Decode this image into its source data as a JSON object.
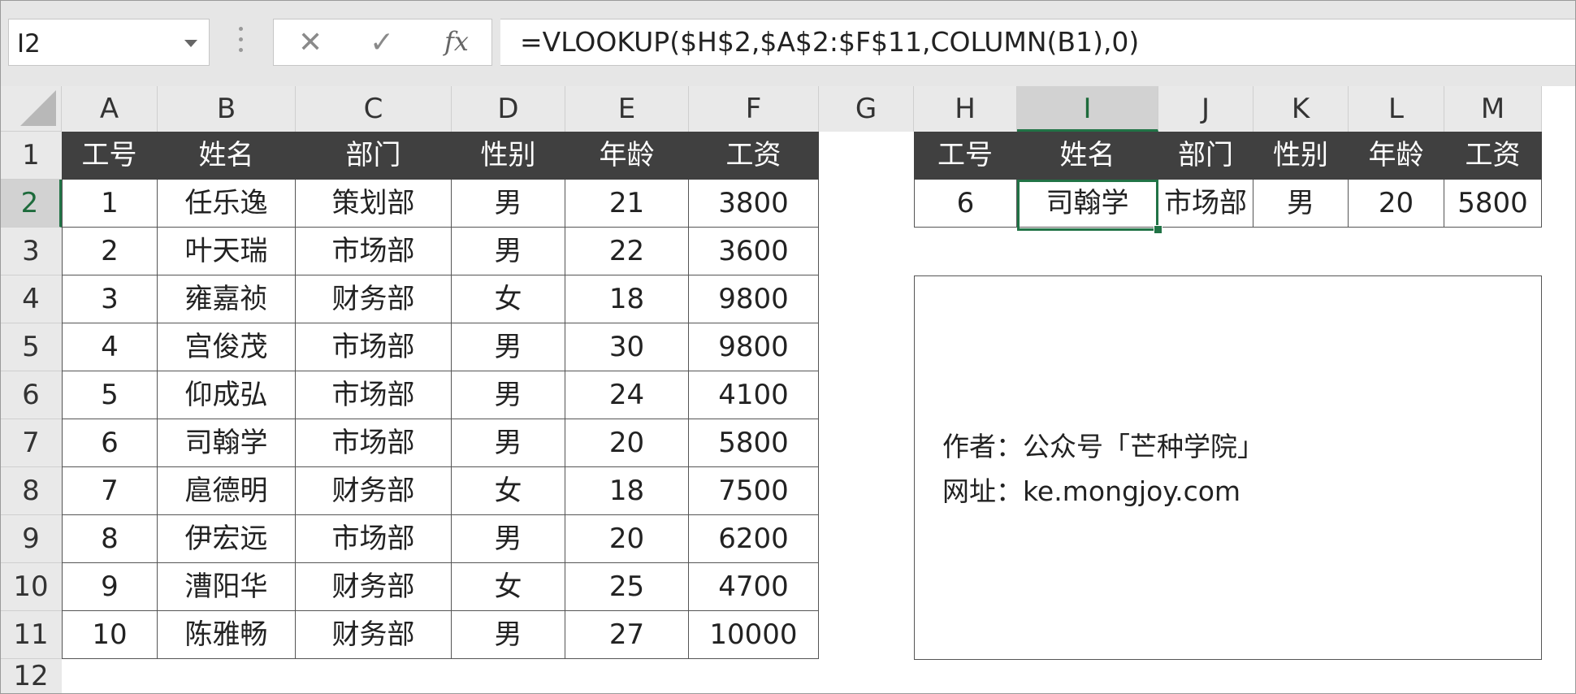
{
  "formula_bar": {
    "name_box": "I2",
    "cancel_icon": "✕",
    "enter_icon": "✓",
    "fx_label": "fx",
    "formula": "=VLOOKUP($H$2,$A$2:$F$11,COLUMN(B1),0)"
  },
  "columns": [
    "A",
    "B",
    "C",
    "D",
    "E",
    "F",
    "G",
    "H",
    "I",
    "J",
    "K",
    "L",
    "M"
  ],
  "rows": [
    "1",
    "2",
    "3",
    "4",
    "5",
    "6",
    "7",
    "8",
    "9",
    "10",
    "11",
    "12"
  ],
  "selected": {
    "column": "I",
    "row": "2"
  },
  "main_table": {
    "headers": [
      "工号",
      "姓名",
      "部门",
      "性别",
      "年龄",
      "工资"
    ],
    "rows": [
      [
        "1",
        "任乐逸",
        "策划部",
        "男",
        "21",
        "3800"
      ],
      [
        "2",
        "叶天瑞",
        "市场部",
        "男",
        "22",
        "3600"
      ],
      [
        "3",
        "雍嘉祯",
        "财务部",
        "女",
        "18",
        "9800"
      ],
      [
        "4",
        "宫俊茂",
        "市场部",
        "男",
        "30",
        "9800"
      ],
      [
        "5",
        "仰成弘",
        "市场部",
        "男",
        "24",
        "4100"
      ],
      [
        "6",
        "司翰学",
        "市场部",
        "男",
        "20",
        "5800"
      ],
      [
        "7",
        "扈德明",
        "财务部",
        "女",
        "18",
        "7500"
      ],
      [
        "8",
        "伊宏远",
        "市场部",
        "男",
        "20",
        "6200"
      ],
      [
        "9",
        "漕阳华",
        "财务部",
        "女",
        "25",
        "4700"
      ],
      [
        "10",
        "陈雅畅",
        "财务部",
        "男",
        "27",
        "10000"
      ]
    ]
  },
  "lookup_table": {
    "headers": [
      "工号",
      "姓名",
      "部门",
      "性别",
      "年龄",
      "工资"
    ],
    "row": [
      "6",
      "司翰学",
      "市场部",
      "男",
      "20",
      "5800"
    ]
  },
  "text_box": {
    "line1": "作者：公众号「芒种学院」",
    "line2": "网址：ke.mongjoy.com"
  }
}
